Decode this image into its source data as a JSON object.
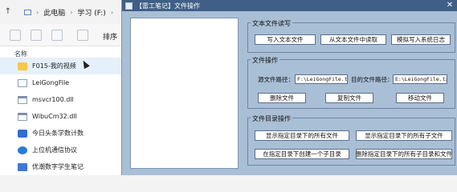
{
  "explorer": {
    "breadcrumb": [
      "此电脑",
      "学习 (F:)"
    ],
    "toolbar": {
      "sort_label": "排序"
    },
    "column_header": "名称",
    "files": [
      {
        "name": "F015-我的视频",
        "icon": "folder-icon"
      },
      {
        "name": "LeiGongFile",
        "icon": "file-icon"
      },
      {
        "name": "msvcr100.dll",
        "icon": "dll-icon"
      },
      {
        "name": "WibuCm32.dll",
        "icon": "dll-icon"
      },
      {
        "name": "今日头条学数计数",
        "icon": "app-icon"
      },
      {
        "name": "上位机通信协议",
        "icon": "network-icon"
      },
      {
        "name": "优潮数字学生笔记",
        "icon": "doc-icon"
      }
    ]
  },
  "window": {
    "title": "【雷工笔记】文件操作",
    "close_glyph": "✕",
    "group_rw": {
      "title": "文本文件读写",
      "btn_write": "写入文本文件",
      "btn_read": "从文本文件中读取",
      "btn_log": "模拟写入系统日志"
    },
    "group_ops": {
      "title": "文件操作",
      "source_label": "源文件路径：",
      "source_value": "F:\\LeiGongFile.txt",
      "target_label": "目的文件路径：",
      "target_value": "E:\\LeiGongFile.txt",
      "btn_delete": "删除文件",
      "btn_copy": "复制文件",
      "btn_move": "移动文件"
    },
    "group_dir": {
      "title": "文件目录操作",
      "btn_show_files": "显示指定目录下的所有文件",
      "btn_show_subdirs": "显示指定目录下的所有子文件",
      "btn_create_subdir": "在指定目录下创建一个子目录",
      "btn_delete_all": "删除指定目录下的所有子目录和文件"
    }
  }
}
